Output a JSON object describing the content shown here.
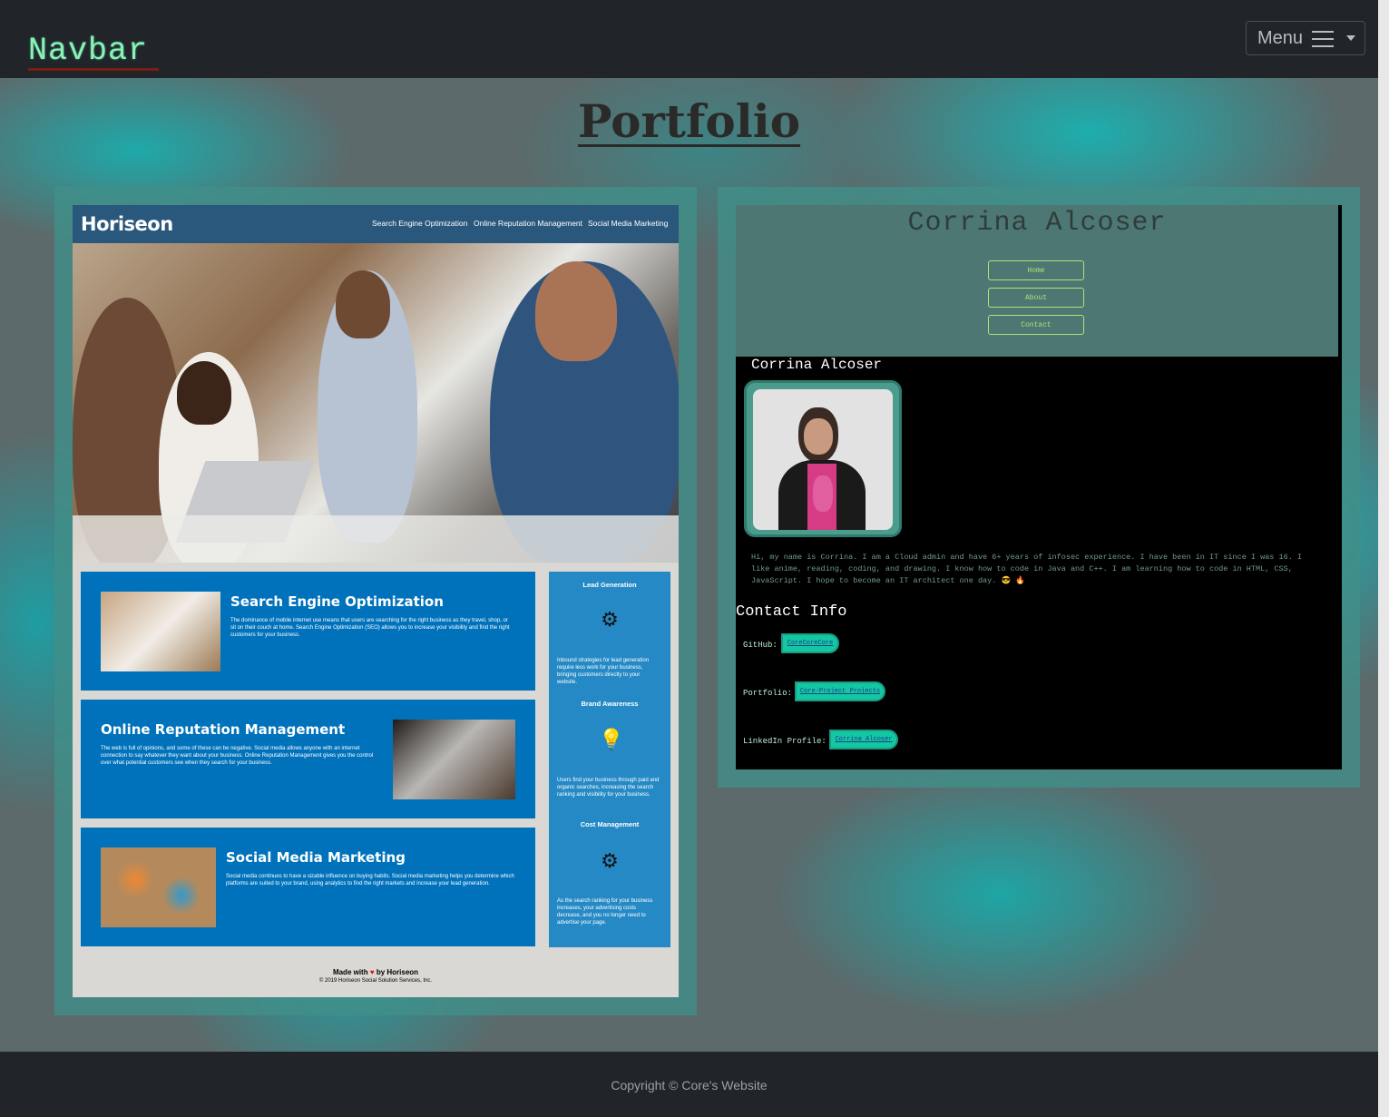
{
  "navbar": {
    "brand": "Navbar",
    "menu_label": "Menu"
  },
  "main": {
    "title": "Portfolio"
  },
  "horiseon": {
    "logo": "Horiseon",
    "nav": [
      "Search Engine Optimization",
      "Online Reputation Management",
      "Social Media Marketing"
    ],
    "services": [
      {
        "title": "Search Engine Optimization",
        "text": "The dominance of mobile internet use means that users are searching for the right business as they travel, shop, or sit on their couch at home. Search Engine Optimization (SEO) allows you to increase your visibility and find the right customers for your business."
      },
      {
        "title": "Online Reputation Management",
        "text": "The web is full of opinions, and some of these can be negative. Social media allows anyone with an internet connection to say whatever they want about your business. Online Reputation Management gives you the control over what potential customers see when they search for your business."
      },
      {
        "title": "Social Media Marketing",
        "text": "Social media continues to have a sizable influence on buying habits. Social media marketing helps you determine which platforms are suited to your brand, using analytics to find the right markets and increase your lead generation."
      }
    ],
    "benefits": [
      {
        "title": "Lead Generation",
        "text": "Inbound strategies for lead generation require less work for your business, bringing customers directly to your website."
      },
      {
        "title": "Brand Awareness",
        "text": "Users find your business through paid and organic searches, increasing the search ranking and visibility for your business."
      },
      {
        "title": "Cost Management",
        "text": "As the search ranking for your business increases, your advertising costs decrease, and you no longer need to advertise your page."
      }
    ],
    "footer_made_prefix": "Made with",
    "footer_made_suffix": "by Horiseon",
    "footer_copyright": "© 2019 Horiseon Social Solution Services, Inc."
  },
  "corrina": {
    "name": "Corrina Alcoser",
    "buttons": [
      "Home",
      "About",
      "Contact"
    ],
    "subheading": "Corrina Alcoser",
    "bio": "Hi, my name is Corrina. I am a Cloud admin and have 6+ years of infosec experience. I have been in IT since I was 16. I like anime, reading, coding, and drawing. I know how to code in Java and C++. I am learning how to code in HTML, CSS, JavaScript. I hope to become an IT architect one day. 😎 🔥",
    "contact_heading": "Contact Info",
    "contacts": [
      {
        "label": "GitHub:",
        "link": "CoreCoreCore"
      },
      {
        "label": "Portfolio:",
        "link": "Core-Project Projects"
      },
      {
        "label": "LinkedIn Profile:",
        "link": "Corrina Alcoser"
      }
    ]
  },
  "footer": {
    "copyright": "Copyright © Core's Website"
  }
}
